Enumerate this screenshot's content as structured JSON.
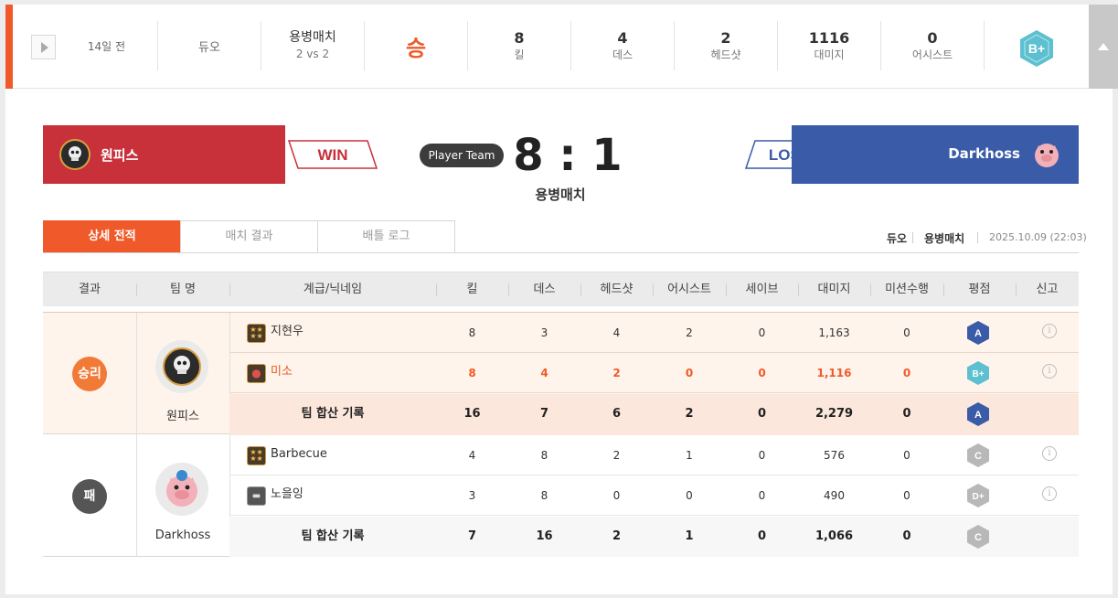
{
  "summary": {
    "time_ago": "14일 전",
    "queue": "듀오",
    "mode": "용병매치",
    "mode_sub": "2 vs 2",
    "result": "승",
    "stats": [
      {
        "value": "8",
        "label": "킬"
      },
      {
        "value": "4",
        "label": "데스"
      },
      {
        "value": "2",
        "label": "헤드샷"
      },
      {
        "value": "1116",
        "label": "대미지"
      },
      {
        "value": "0",
        "label": "어시스트"
      }
    ],
    "grade": "B+"
  },
  "banner": {
    "left_team": "원피스",
    "left_result": "WIN",
    "player_team_badge": "Player Team",
    "score": "8 : 1",
    "mode": "용병매치",
    "right_result": "LOSE",
    "right_team": "Darkhoss"
  },
  "tabs": [
    "상세 전적",
    "매치 결과",
    "배틀 로그"
  ],
  "meta": {
    "queue": "듀오",
    "mode": "용병매치",
    "datetime": "2025.10.09 (22:03)"
  },
  "table": {
    "headers": [
      "결과",
      "팀 명",
      "계급/닉네임",
      "킬",
      "데스",
      "헤드샷",
      "어시스트",
      "세이브",
      "대미지",
      "미션수행",
      "평점",
      "신고"
    ],
    "groups": [
      {
        "result": "승리",
        "team": "원피스",
        "players": [
          {
            "name": "지현우",
            "kill": "8",
            "death": "3",
            "headshot": "4",
            "assist": "2",
            "save": "0",
            "damage": "1,163",
            "mission": "0",
            "grade": "A"
          },
          {
            "name": "미소",
            "kill": "8",
            "death": "4",
            "headshot": "2",
            "assist": "0",
            "save": "0",
            "damage": "1,116",
            "mission": "0",
            "grade": "B+"
          }
        ],
        "total": {
          "label": "팀 합산 기록",
          "kill": "16",
          "death": "7",
          "headshot": "6",
          "assist": "2",
          "save": "0",
          "damage": "2,279",
          "mission": "0",
          "grade": "A"
        }
      },
      {
        "result": "패",
        "team": "Darkhoss",
        "players": [
          {
            "name": "Barbecue",
            "kill": "4",
            "death": "8",
            "headshot": "2",
            "assist": "1",
            "save": "0",
            "damage": "576",
            "mission": "0",
            "grade": "C"
          },
          {
            "name": "노을잉",
            "kill": "3",
            "death": "8",
            "headshot": "0",
            "assist": "0",
            "save": "0",
            "damage": "490",
            "mission": "0",
            "grade": "D+"
          }
        ],
        "total": {
          "label": "팀 합산 기록",
          "kill": "7",
          "death": "16",
          "headshot": "2",
          "assist": "1",
          "save": "0",
          "damage": "1,066",
          "mission": "0",
          "grade": "C"
        }
      }
    ]
  },
  "colors": {
    "accent": "#f05a2a",
    "win_red": "#c8303a",
    "lose_blue": "#3a5ba8",
    "grade_A": "#3a5ba8",
    "grade_Bplus": "#5cc0d0",
    "grade_C": "#b8b8b8"
  }
}
